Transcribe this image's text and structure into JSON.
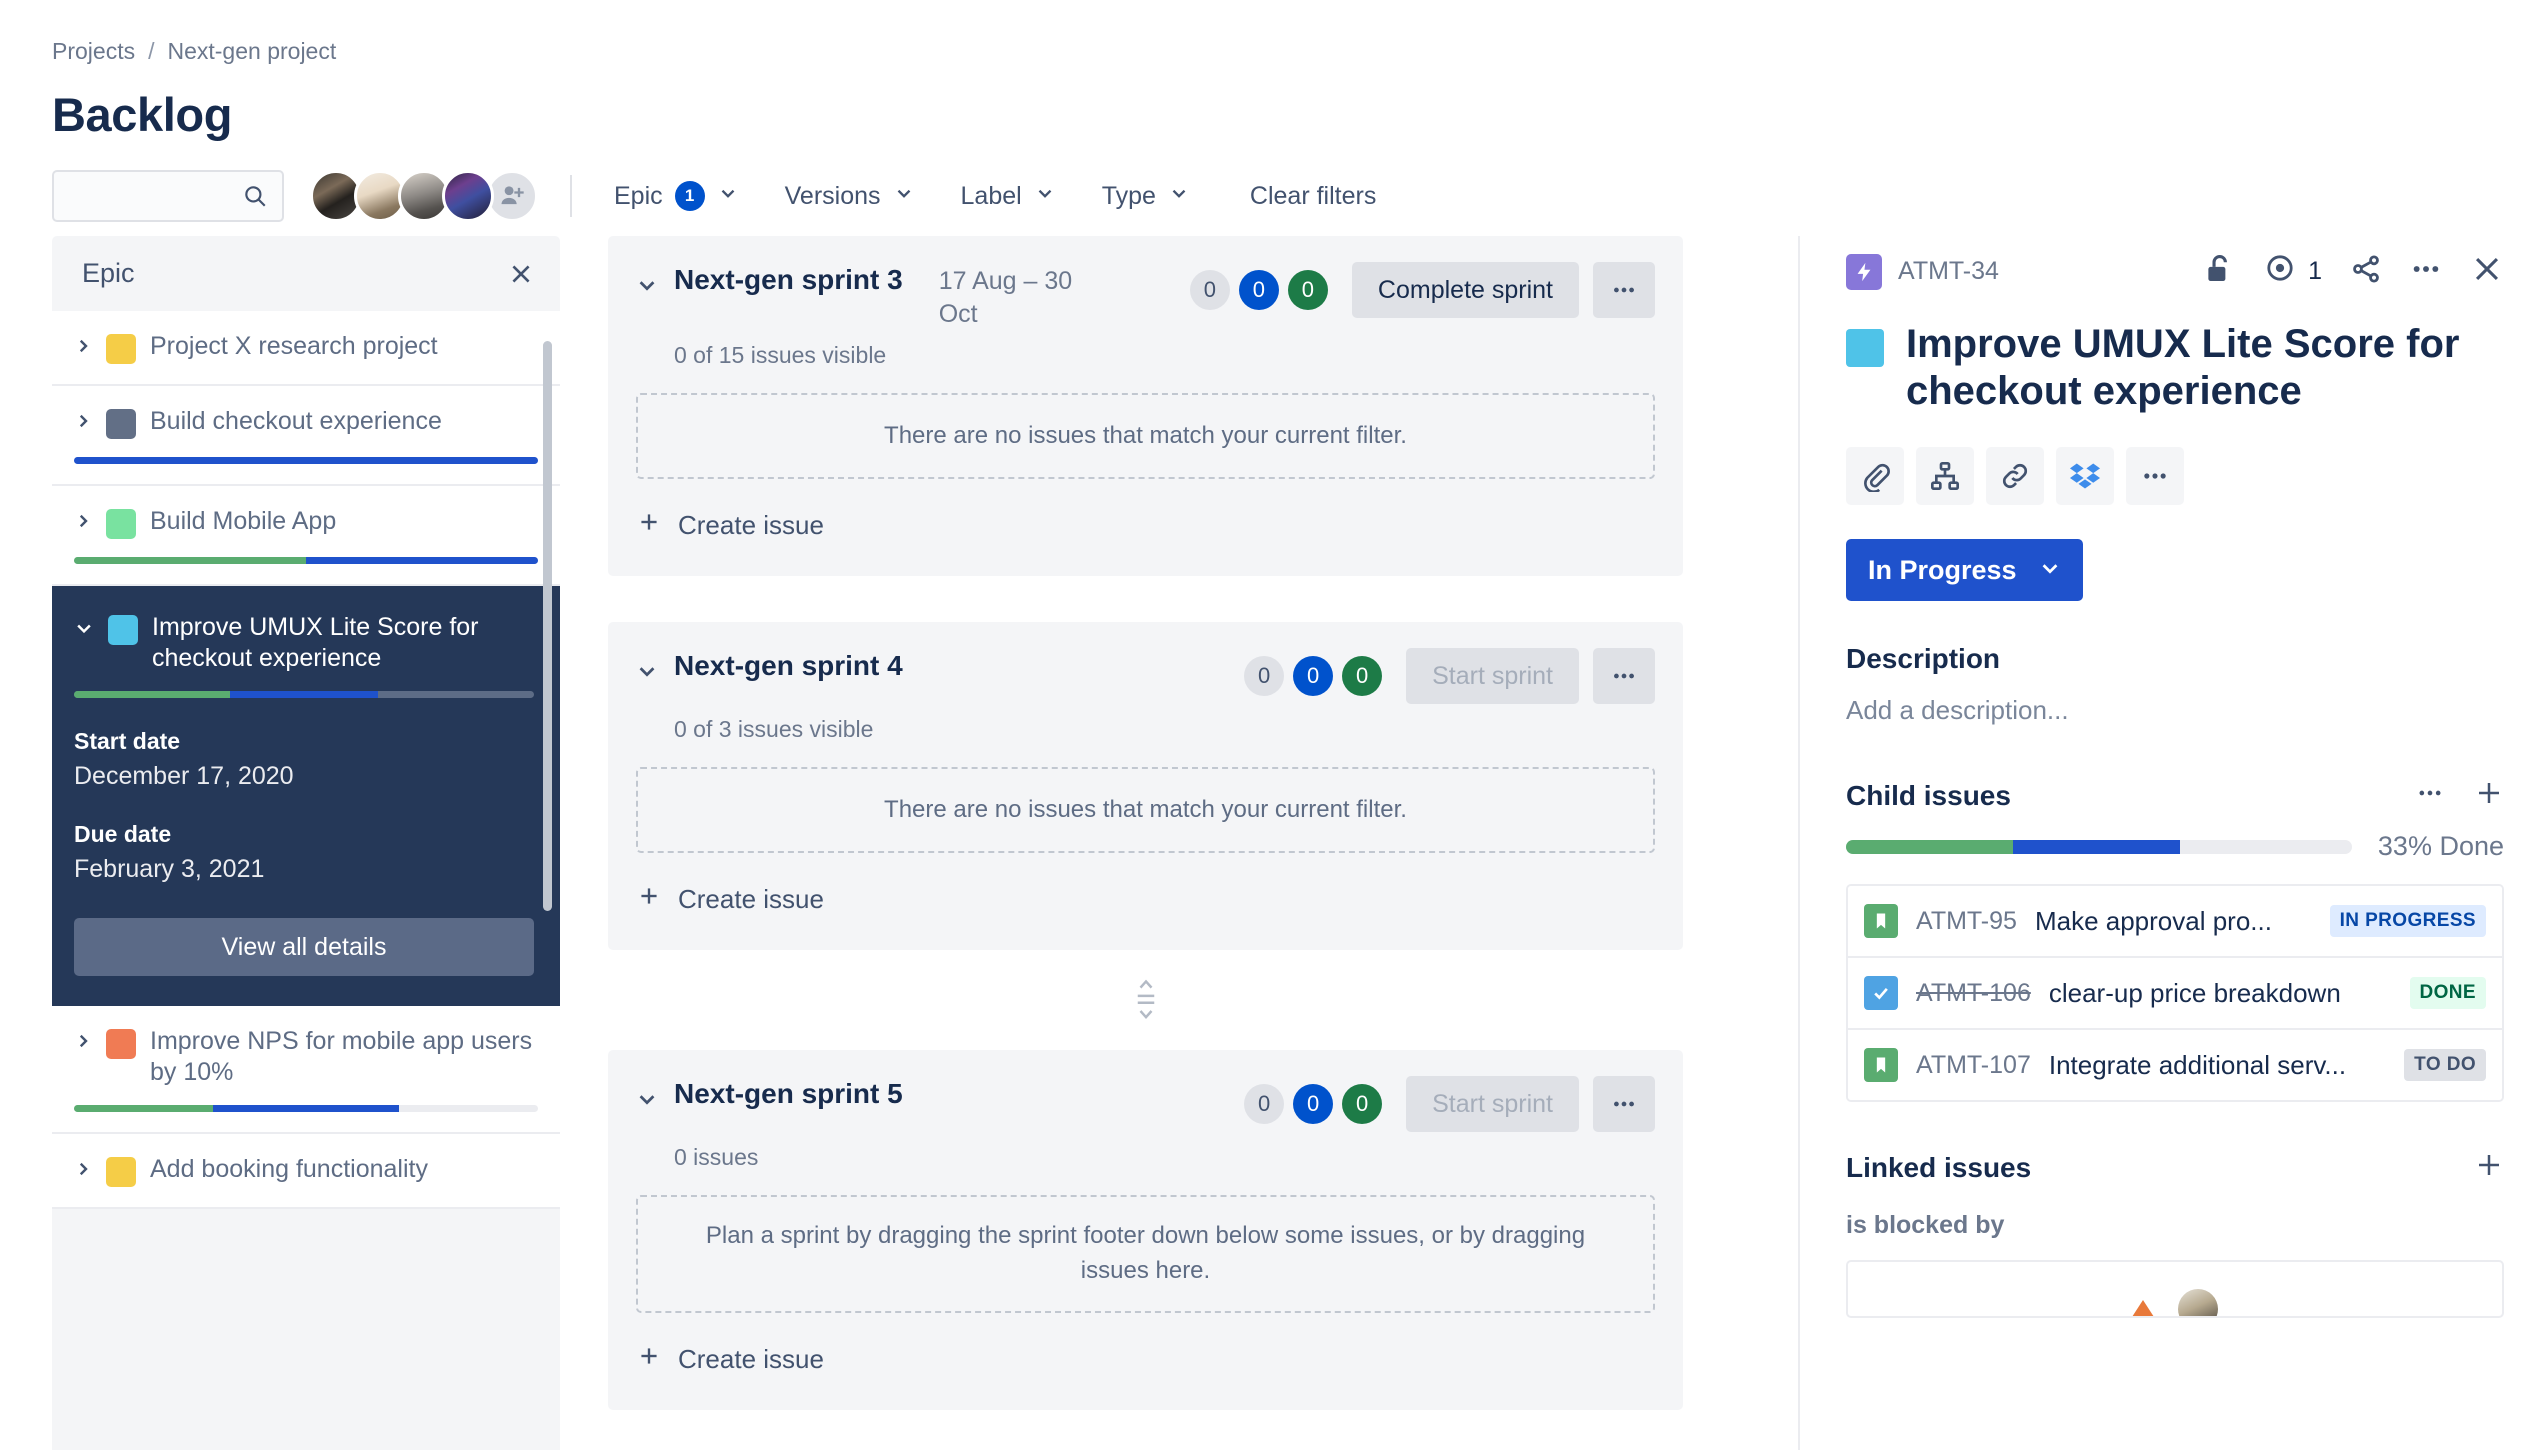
{
  "breadcrumb": {
    "projects": "Projects",
    "separator": "/",
    "project": "Next-gen project"
  },
  "page_title": "Backlog",
  "search": {
    "value": "",
    "placeholder": ""
  },
  "filters": {
    "epic": {
      "label": "Epic",
      "count": "1"
    },
    "versions": {
      "label": "Versions"
    },
    "label": {
      "label": "Label"
    },
    "type": {
      "label": "Type"
    },
    "clear": "Clear filters"
  },
  "epic_panel": {
    "title": "Epic",
    "items": [
      {
        "name": "Project X research project",
        "color": "#f5cd47",
        "caret": "right",
        "progress": {
          "done": 0,
          "inprogress": 0
        }
      },
      {
        "name": "Build checkout experience",
        "color": "#626f86",
        "caret": "right",
        "progress": {
          "done": 0,
          "inprogress": 100
        }
      },
      {
        "name": "Build Mobile App",
        "color": "#79e2a0",
        "caret": "right",
        "progress": {
          "done": 50,
          "inprogress": 50
        }
      },
      {
        "name": "Improve UMUX Lite Score for checkout experience",
        "color": "#4fc3e8",
        "caret": "down",
        "selected": true,
        "progress": {
          "done": 34,
          "inprogress": 66
        },
        "start_date_label": "Start date",
        "start_date": "December 17, 2020",
        "due_date_label": "Due date",
        "due_date": "February 3, 2021",
        "view_all": "View all details"
      },
      {
        "name": "Improve NPS for mobile app users by 10%",
        "color": "#f07b54",
        "caret": "right",
        "progress": {
          "done": 37,
          "inprogress": 37
        }
      },
      {
        "name": "Add booking functionality",
        "color": "#f5cd47",
        "caret": "right",
        "progress": {
          "done": 0,
          "inprogress": 0
        }
      }
    ]
  },
  "sprints": [
    {
      "name": "Next-gen sprint 3",
      "dates": "17 Aug – 30 Oct",
      "counts": {
        "todo": "0",
        "inprogress": "0",
        "done": "0"
      },
      "action": "Complete sprint",
      "action_disabled": false,
      "subtitle": "0 of 15 issues visible",
      "empty_text": "There are no issues that match your current filter.",
      "create_issue": "Create issue"
    },
    {
      "name": "Next-gen sprint 4",
      "dates": "",
      "counts": {
        "todo": "0",
        "inprogress": "0",
        "done": "0"
      },
      "action": "Start sprint",
      "action_disabled": true,
      "subtitle": "0 of 3 issues visible",
      "empty_text": "There are no issues that match your current filter.",
      "create_issue": "Create issue"
    },
    {
      "name": "Next-gen sprint 5",
      "dates": "",
      "counts": {
        "todo": "0",
        "inprogress": "0",
        "done": "0"
      },
      "action": "Start sprint",
      "action_disabled": true,
      "subtitle": "0 issues",
      "empty_text": "Plan a sprint by dragging the sprint footer down below some issues, or by dragging issues here.",
      "create_issue": "Create issue"
    }
  ],
  "detail": {
    "issue_key": "ATMT-34",
    "watchers": "1",
    "title": "Improve UMUX Lite Score for checkout experience",
    "title_color": "#4fc3e8",
    "status": "In Progress",
    "description": {
      "title": "Description",
      "placeholder": "Add a description..."
    },
    "child_issues": {
      "title": "Child issues",
      "percent_done": "33% Done",
      "progress": {
        "done": 33,
        "inprogress": 33
      },
      "rows": [
        {
          "key": "ATMT-95",
          "summary": "Make approval pro...",
          "badge": "IN PROGRESS",
          "badge_type": "inprogress",
          "icon": "story-icon",
          "struck": false
        },
        {
          "key": "ATMT-106",
          "summary": "clear-up price breakdown",
          "badge": "DONE",
          "badge_type": "done",
          "icon": "check-icon",
          "struck": true
        },
        {
          "key": "ATMT-107",
          "summary": "Integrate additional serv...",
          "badge": "TO DO",
          "badge_type": "todo",
          "icon": "story-icon",
          "struck": false
        }
      ]
    },
    "linked_issues": {
      "title": "Linked issues",
      "relation": "is blocked by"
    }
  }
}
